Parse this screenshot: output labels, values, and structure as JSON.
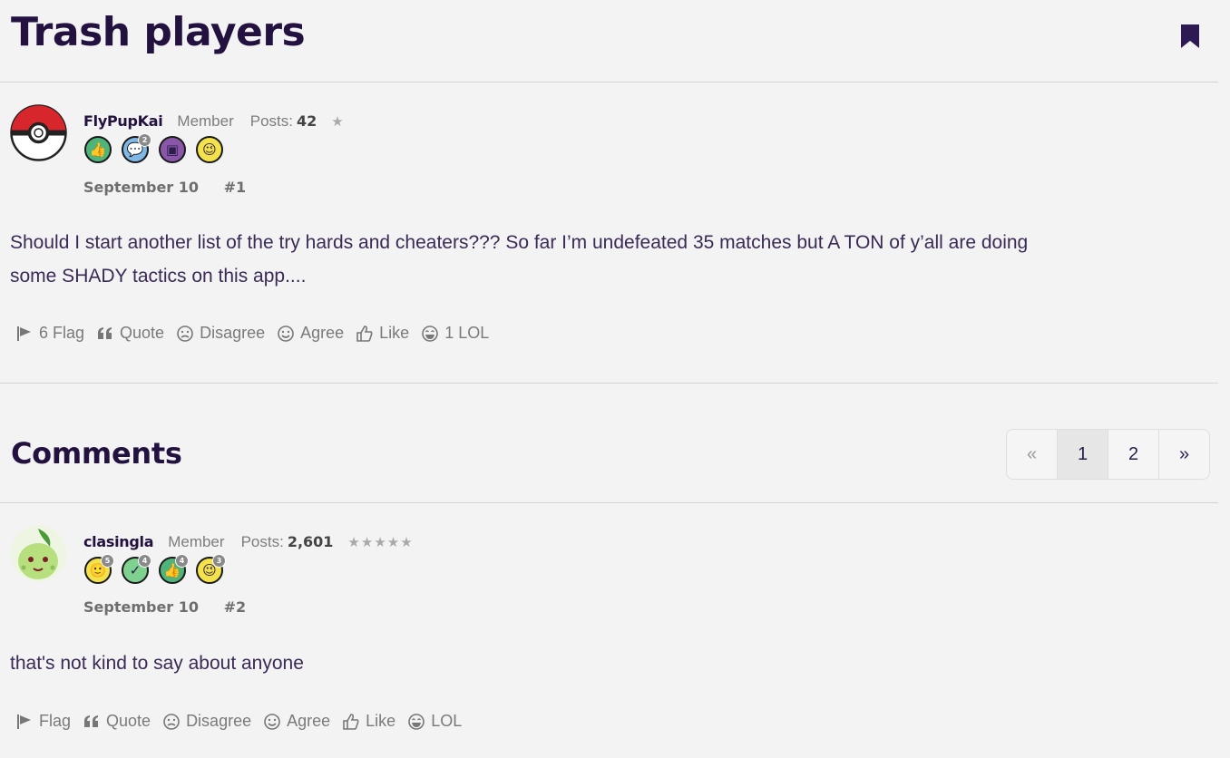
{
  "thread": {
    "title": "Trash players",
    "bookmark_icon": "bookmark-icon"
  },
  "post1": {
    "username": "FlyPupKai",
    "role": "Member",
    "posts_label": "Posts:",
    "posts_count": "42",
    "stars": "★",
    "badges": [
      {
        "icon": "thumbs-up-icon",
        "glyph": "👍",
        "color": "#4fb47a",
        "count": ""
      },
      {
        "icon": "comment-icon",
        "glyph": "💬",
        "color": "#7fb8e6",
        "count": "2"
      },
      {
        "icon": "photo-icon",
        "glyph": "▣",
        "color": "#8a56a8",
        "count": ""
      },
      {
        "icon": "wink-icon",
        "glyph": "😉",
        "color": "#f4e24a",
        "count": ""
      }
    ],
    "date": "September 10",
    "number": "#1",
    "body_line1": "Should I start another list of the try hards and cheaters??? So far I’m undefeated 35 matches but A TON of y’all are doing",
    "body_line2": "some SHADY tactics on this app....",
    "actions": {
      "flag": "6 Flag",
      "quote": "Quote",
      "disagree": "Disagree",
      "agree": "Agree",
      "like": "Like",
      "lol": "1 LOL"
    }
  },
  "comments": {
    "heading": "Comments",
    "pagination": {
      "prev": "«",
      "pages": [
        "1",
        "2"
      ],
      "current": "1",
      "next": "»"
    }
  },
  "post2": {
    "username": "clasingla",
    "role": "Member",
    "posts_label": "Posts:",
    "posts_count": "2,601",
    "stars": "★★★★★",
    "badges": [
      {
        "icon": "smile-icon",
        "glyph": "🙂",
        "color": "#f4e24a",
        "count": "5"
      },
      {
        "icon": "check-icon",
        "glyph": "✓",
        "color": "#7fd18f",
        "count": "4"
      },
      {
        "icon": "thumbs-up-icon",
        "glyph": "👍",
        "color": "#4fb47a",
        "count": "4"
      },
      {
        "icon": "wink-icon",
        "glyph": "😉",
        "color": "#f4e24a",
        "count": "3"
      }
    ],
    "date": "September 10",
    "number": "#2",
    "body_line1": "that's not kind to say about anyone",
    "actions": {
      "flag": "Flag",
      "quote": "Quote",
      "disagree": "Disagree",
      "agree": "Agree",
      "like": "Like",
      "lol": "LOL"
    }
  }
}
